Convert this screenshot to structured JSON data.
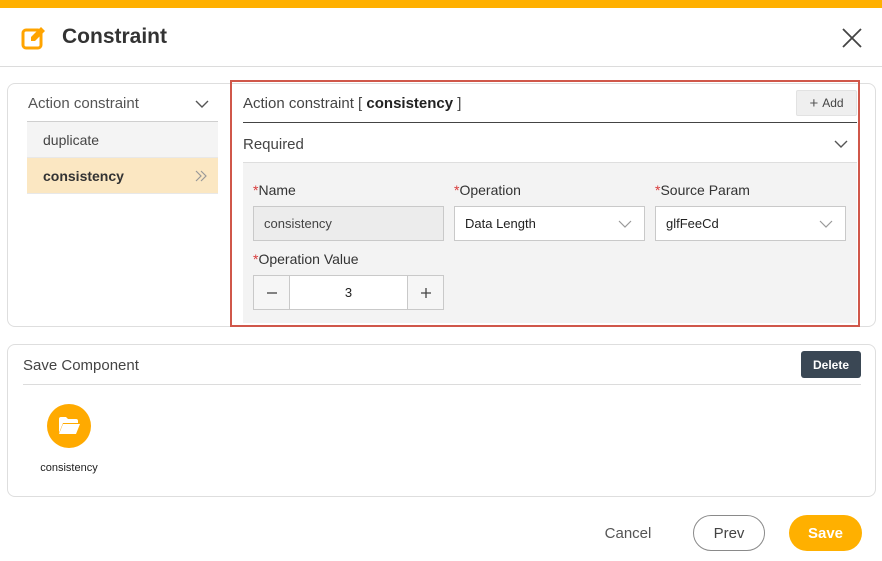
{
  "dialog": {
    "title": "Constraint",
    "accent_color": "#ffb000",
    "title_icon": "edit-icon",
    "close_icon": "close-icon"
  },
  "left_nav": {
    "header": "Action constraint",
    "items": [
      {
        "label": "duplicate",
        "active": false
      },
      {
        "label": "consistency",
        "active": true
      }
    ]
  },
  "right_panel": {
    "title_prefix": "Action constraint [ ",
    "title_value": "consistency",
    "title_suffix": " ]",
    "add_label": "Add",
    "section_label": "Required",
    "highlight_color": "#d0574a",
    "form": {
      "name_label": "Name",
      "name_value": "consistency",
      "operation_label": "Operation",
      "operation_value": "Data Length",
      "source_param_label": "Source Param",
      "source_param_value": "glfFeeCd",
      "operation_value_label": "Operation Value",
      "operation_value_value": "3",
      "required_mark": "*"
    }
  },
  "save_component": {
    "title": "Save Component",
    "delete_label": "Delete",
    "components": [
      {
        "name": "consistency",
        "icon": "folder-open-icon"
      }
    ]
  },
  "footer": {
    "cancel_label": "Cancel",
    "prev_label": "Prev",
    "save_label": "Save"
  }
}
